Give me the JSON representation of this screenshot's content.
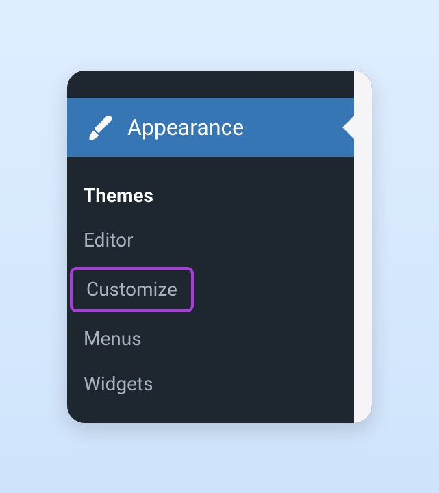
{
  "menu": {
    "header": "Appearance",
    "items": [
      {
        "label": "Themes"
      },
      {
        "label": "Editor"
      },
      {
        "label": "Customize"
      },
      {
        "label": "Menus"
      },
      {
        "label": "Widgets"
      }
    ]
  }
}
